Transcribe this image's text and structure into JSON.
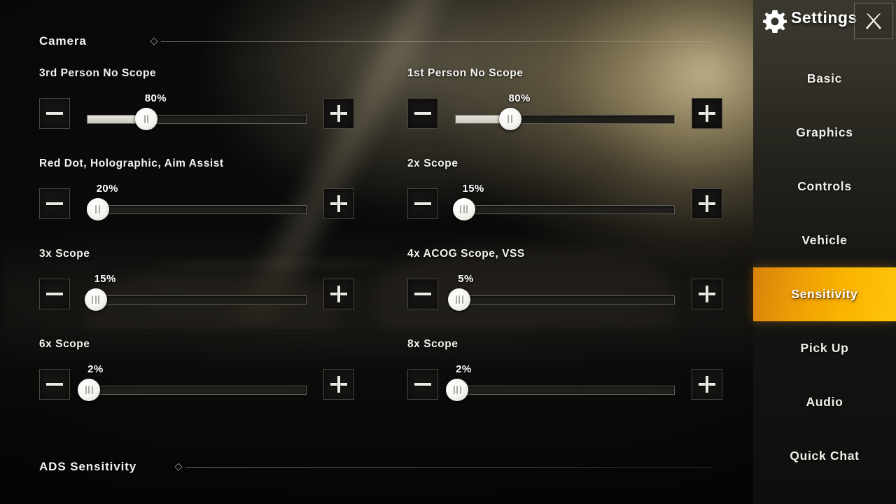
{
  "header": {
    "title": "Settings",
    "gear_icon": "gear-icon",
    "close_icon": "close-icon"
  },
  "sidebar": {
    "items": [
      {
        "label": "Basic",
        "active": false
      },
      {
        "label": "Graphics",
        "active": false
      },
      {
        "label": "Controls",
        "active": false
      },
      {
        "label": "Vehicle",
        "active": false
      },
      {
        "label": "Sensitivity",
        "active": true
      },
      {
        "label": "Pick Up",
        "active": false
      },
      {
        "label": "Audio",
        "active": false
      },
      {
        "label": "Quick Chat",
        "active": false
      }
    ],
    "active_color": "#f9b300",
    "active_color_start": "#d8820a"
  },
  "sections": [
    {
      "title": "Camera"
    },
    {
      "title": "ADS Sensitivity"
    }
  ],
  "sliders": [
    {
      "label": "3rd Person No Scope",
      "value": "80%",
      "knob_pct": 27,
      "fill_pct": 27,
      "grips": 2,
      "decrease_label": "−",
      "increase_label": "+"
    },
    {
      "label": "1st Person No Scope",
      "value": "80%",
      "knob_pct": 25,
      "fill_pct": 25,
      "grips": 2,
      "decrease_label": "−",
      "increase_label": "+"
    },
    {
      "label": "Red Dot, Holographic, Aim Assist",
      "value": "20%",
      "knob_pct": 5,
      "fill_pct": 5,
      "grips": 2,
      "decrease_label": "−",
      "increase_label": "+"
    },
    {
      "label": "2x Scope",
      "value": "15%",
      "knob_pct": 4,
      "fill_pct": 4,
      "grips": 3,
      "decrease_label": "−",
      "increase_label": "+"
    },
    {
      "label": "3x Scope",
      "value": "15%",
      "knob_pct": 4,
      "fill_pct": 4,
      "grips": 3,
      "decrease_label": "−",
      "increase_label": "+"
    },
    {
      "label": "4x ACOG Scope, VSS",
      "value": "5%",
      "knob_pct": 2,
      "fill_pct": 2,
      "grips": 3,
      "decrease_label": "−",
      "increase_label": "+"
    },
    {
      "label": "6x Scope",
      "value": "2%",
      "knob_pct": 1,
      "fill_pct": 1,
      "grips": 3,
      "decrease_label": "−",
      "increase_label": "+"
    },
    {
      "label": "8x Scope",
      "value": "2%",
      "knob_pct": 1,
      "fill_pct": 1,
      "grips": 3,
      "decrease_label": "−",
      "increase_label": "+"
    }
  ]
}
